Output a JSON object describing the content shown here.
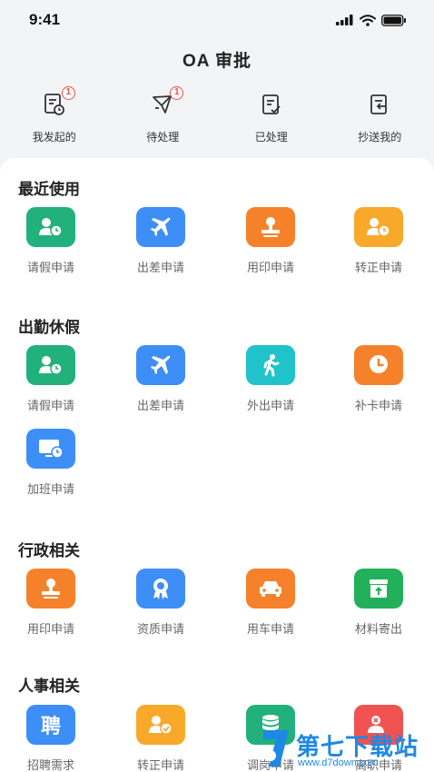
{
  "status_bar": {
    "time": "9:41"
  },
  "header": {
    "title": "OA 审批"
  },
  "top_tabs": [
    {
      "label": "我发起的",
      "icon": "doc-clock-icon",
      "badge": "1"
    },
    {
      "label": "待处理",
      "icon": "paper-plane-icon",
      "badge": "1"
    },
    {
      "label": "已处理",
      "icon": "doc-check-icon"
    },
    {
      "label": "抄送我的",
      "icon": "doc-arrow-icon"
    }
  ],
  "sections": {
    "recent": {
      "title": "最近使用",
      "items": [
        {
          "label": "请假申请",
          "icon": "person-clock-icon",
          "color": "#22b07d"
        },
        {
          "label": "出差申请",
          "icon": "airplane-icon",
          "color": "#3d8ef7"
        },
        {
          "label": "用印申请",
          "icon": "stamp-icon",
          "color": "#f5822a"
        },
        {
          "label": "转正申请",
          "icon": "person-clock-icon",
          "color": "#f8a92a"
        }
      ]
    },
    "attendance": {
      "title": "出勤休假",
      "items": [
        {
          "label": "请假申请",
          "icon": "person-clock-icon",
          "color": "#22b07d"
        },
        {
          "label": "出差申请",
          "icon": "airplane-icon",
          "color": "#3d8ef7"
        },
        {
          "label": "外出申请",
          "icon": "walking-person-icon",
          "color": "#20c3c9"
        },
        {
          "label": "补卡申请",
          "icon": "clock-pin-icon",
          "color": "#f5822a"
        },
        {
          "label": "加班申请",
          "icon": "monitor-clock-icon",
          "color": "#3d8ef7"
        }
      ]
    },
    "admin": {
      "title": "行政相关",
      "items": [
        {
          "label": "用印申请",
          "icon": "stamp-icon",
          "color": "#f5822a"
        },
        {
          "label": "资质申请",
          "icon": "award-ribbon-icon",
          "color": "#3d8ef7"
        },
        {
          "label": "用车申请",
          "icon": "car-icon",
          "color": "#f5822a"
        },
        {
          "label": "材料寄出",
          "icon": "box-upload-icon",
          "color": "#22b05a"
        }
      ]
    },
    "hr": {
      "title": "人事相关",
      "items": [
        {
          "label": "招聘需求",
          "icon": "recruit-char-icon",
          "char": "聘",
          "color": "#3d8ef7"
        },
        {
          "label": "转正申请",
          "icon": "person-check-icon",
          "color": "#f8a92a"
        },
        {
          "label": "调岗申请",
          "icon": "database-icon",
          "color": "#22b07d"
        },
        {
          "label": "离职申请",
          "icon": "person-x-icon",
          "color": "#f05252"
        }
      ]
    }
  },
  "watermark": {
    "main": "第七下载站",
    "sub": "www.d7down.com"
  }
}
